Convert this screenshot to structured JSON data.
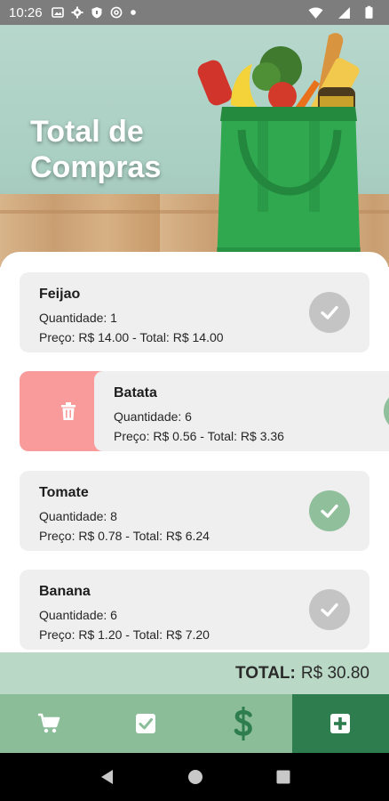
{
  "status_bar": {
    "time": "10:26",
    "left_icons": [
      "image-icon",
      "gear-icon",
      "shield-icon",
      "at-icon",
      "dot-icon"
    ],
    "right_icons": [
      "wifi-icon",
      "signal-icon",
      "battery-icon"
    ]
  },
  "hero": {
    "title_line1": "Total de",
    "title_line2": "Compras"
  },
  "items": [
    {
      "name": "Feijao",
      "qty": "Quantidade: 1",
      "price": "Preço: R$ 14.00 - Total: R$ 14.00",
      "checked": false
    },
    {
      "name": "Batata",
      "qty": "Quantidade: 6",
      "price": "Preço: R$ 0.56 - Total: R$ 3.36",
      "checked": true,
      "swiped": true
    },
    {
      "name": "Tomate",
      "qty": "Quantidade: 8",
      "price": "Preço: R$ 0.78 - Total: R$ 6.24",
      "checked": true
    },
    {
      "name": "Banana",
      "qty": "Quantidade: 6",
      "price": "Preço: R$ 1.20 - Total: R$ 7.20",
      "checked": false
    }
  ],
  "total": {
    "label": "TOTAL:",
    "value": "R$ 30.80"
  },
  "bottom_nav": {
    "items": [
      "cart-icon",
      "checklist-icon",
      "dollar-icon",
      "add-icon"
    ],
    "active": "add-icon"
  },
  "system_nav": [
    "back-icon",
    "home-icon",
    "recents-icon"
  ],
  "colors": {
    "accent_dark": "#2e7d4f",
    "nav_bg": "#8bbd99",
    "total_bg": "#b9d8c5",
    "check_done": "#8fbf9b",
    "check_pending": "#c4c4c4",
    "delete_bg": "#f99b9b"
  }
}
